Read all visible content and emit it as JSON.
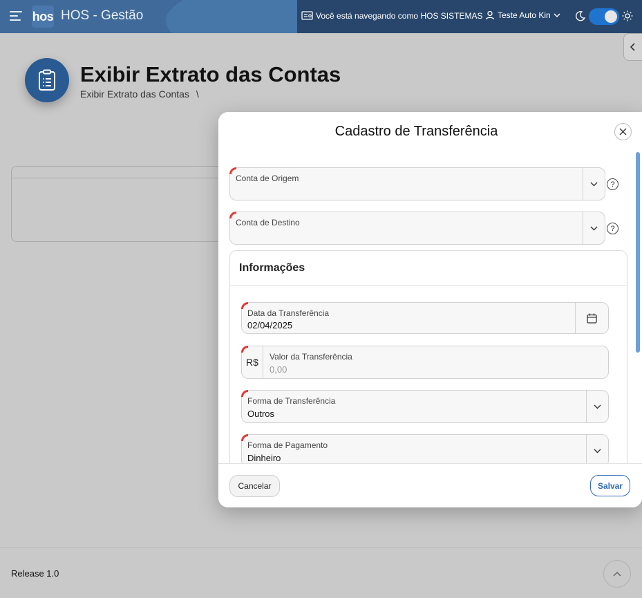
{
  "app": {
    "logo_text": "hos",
    "title": "HOS - Gestão",
    "navigating_as": "Você está navegando como HOS SISTEMAS",
    "user_name": "Teste Auto Kin"
  },
  "page": {
    "title": "Exibir Extrato das Contas",
    "breadcrumb": "Exibir Extrato das Contas",
    "breadcrumb_sep": "\\"
  },
  "footer": {
    "release": "Release 1.0"
  },
  "modal": {
    "title": "Cadastro de Transferência",
    "fields": {
      "conta_origem": {
        "label": "Conta de Origem",
        "value": ""
      },
      "conta_destino": {
        "label": "Conta de Destino",
        "value": ""
      }
    },
    "section": {
      "title": "Informações",
      "data": {
        "label": "Data da Transferência",
        "value": "02/04/2025"
      },
      "valor": {
        "prefix": "R$",
        "label": "Valor da Transferência",
        "placeholder": "0,00"
      },
      "forma_transferencia": {
        "label": "Forma de Transferência",
        "value": "Outros"
      },
      "forma_pagamento": {
        "label": "Forma de Pagamento",
        "value": "Dinheiro"
      }
    },
    "buttons": {
      "cancel": "Cancelar",
      "save": "Salvar"
    }
  },
  "colors": {
    "topbar": "#3f6a9a",
    "primary": "#2f6ab4",
    "required_marker": "#e53935",
    "overlay": "#c9c9c9"
  }
}
